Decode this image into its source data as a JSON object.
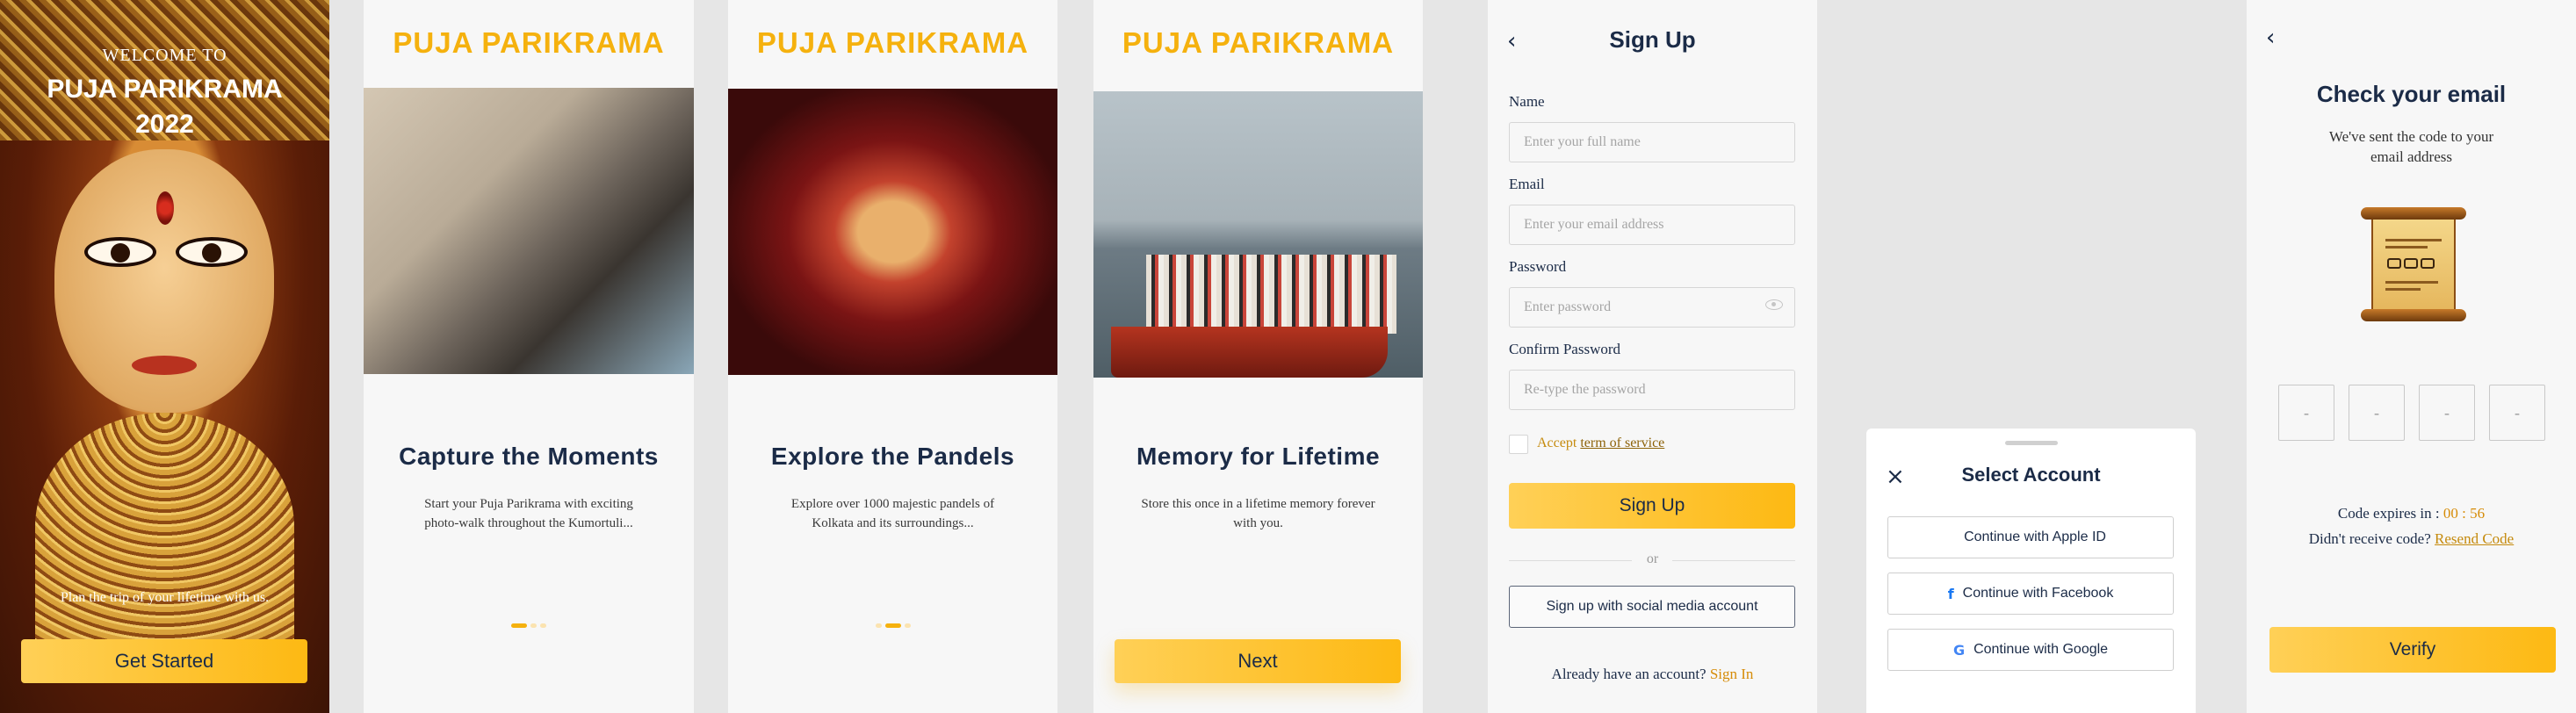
{
  "colors": {
    "accent": "#f5b10e",
    "navy": "#1b2b47",
    "link": "#d68c08"
  },
  "splash": {
    "welcome": "WELCOME TO",
    "title_line1": "PUJA PARIKRAMA",
    "title_line2": "2022",
    "tagline": "Plan the trip of your lifetime with us.",
    "cta": "Get Started"
  },
  "brand": "PUJA PARIKRAMA",
  "onboarding": [
    {
      "title": "Capture the Moments",
      "desc": "Start your Puja Parikrama with exciting photo-walk throughout the Kumortuli...",
      "active_dot": 1
    },
    {
      "title": "Explore the Pandels",
      "desc": "Explore over 1000 majestic pandels of Kolkata and its surroundings...",
      "active_dot": 2
    },
    {
      "title": "Memory for Lifetime",
      "desc": "Store this once in a lifetime memory forever with you.",
      "next": "Next"
    }
  ],
  "signup": {
    "title": "Sign Up",
    "name_label": "Name",
    "name_placeholder": "Enter your full name",
    "email_label": "Email",
    "email_placeholder": "Enter your email address",
    "password_label": "Password",
    "password_placeholder": "Enter password",
    "confirm_label": "Confirm Password",
    "confirm_placeholder": "Re-type the password",
    "accept": "Accept",
    "terms": "term of service",
    "submit": "Sign Up",
    "or": "or",
    "social": "Sign up with social media account",
    "have_account": "Already have an account?",
    "signin": "Sign In"
  },
  "select_account": {
    "title": "Select Account",
    "options": [
      {
        "label": "Continue with Apple ID",
        "icon": "apple-icon"
      },
      {
        "label": "Continue with Facebook",
        "icon": "facebook-icon"
      },
      {
        "label": "Continue with Google",
        "icon": "google-icon"
      }
    ]
  },
  "verify": {
    "title": "Check your email",
    "subtitle": "We've sent the code to your email address",
    "otp": [
      "-",
      "-",
      "-",
      "-"
    ],
    "expires_label": "Code expires in :",
    "expires_time": "00 : 56",
    "no_code": "Didn't receive code?",
    "resend": "Resend Code",
    "submit": "Verify"
  }
}
